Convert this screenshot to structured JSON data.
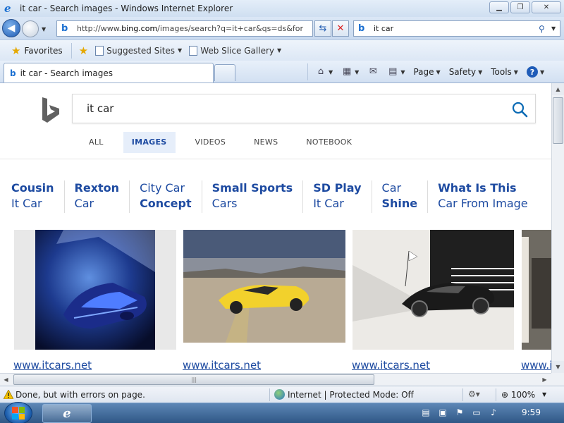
{
  "window": {
    "title": "it car - Search images - Windows Internet Explorer",
    "buttons": {
      "minimize": "▁",
      "restore": "❐",
      "close": "✕"
    }
  },
  "address_bar": {
    "url_prefix": "http://www.",
    "url_host": "bing.com",
    "url_path": "/images/search?q=it+car&qs=ds&for"
  },
  "search_box": {
    "query": "it car"
  },
  "favorites_bar": {
    "favorites_label": "Favorites",
    "items": [
      {
        "label": "Suggested Sites"
      },
      {
        "label": "Web Slice Gallery"
      }
    ]
  },
  "tabs": [
    {
      "label": "it car - Search images"
    }
  ],
  "command_bar": {
    "page": "Page",
    "safety": "Safety",
    "tools": "Tools",
    "help": "?"
  },
  "page": {
    "query": "it car",
    "scopes": [
      "ALL",
      "IMAGES",
      "VIDEOS",
      "NEWS",
      "NOTEBOOK"
    ],
    "active_scope": "IMAGES",
    "related": [
      {
        "line1": "Cousin",
        "line2": "It Car"
      },
      {
        "line1": "Rexton",
        "line2": "Car"
      },
      {
        "line1": "City Car",
        "line2": "Concept"
      },
      {
        "line1": "Small Sports",
        "line2": "Cars"
      },
      {
        "line1": "SD Play",
        "line2": "It Car"
      },
      {
        "line1": "Car",
        "line2": "Shine"
      },
      {
        "line1": "What Is This",
        "line2": "Car From Image"
      }
    ],
    "results": [
      {
        "source": "www.itcars.net",
        "icon": "blue-concept-car-image"
      },
      {
        "source": "www.itcars.net",
        "icon": "yellow-sports-car-image"
      },
      {
        "source": "www.itcars.net",
        "icon": "black-concept-car-image"
      },
      {
        "source": "www.i",
        "icon": "partial-car-image"
      }
    ]
  },
  "status_bar": {
    "message": "Done, but with errors on page.",
    "zone": "Internet | Protected Mode: Off",
    "zoom": "100%"
  },
  "taskbar": {
    "clock": "9:59"
  }
}
